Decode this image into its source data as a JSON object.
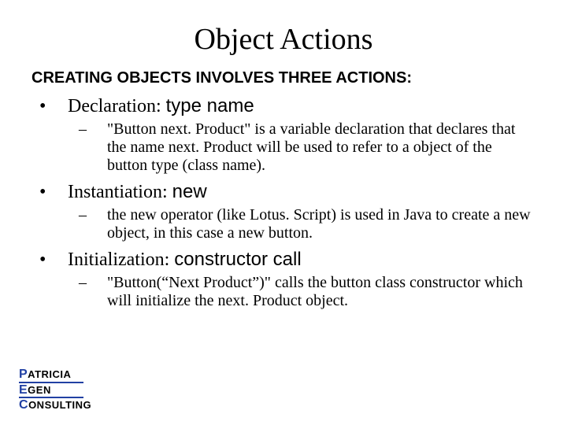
{
  "title": "Object Actions",
  "subtitle": "CREATING OBJECTS INVOLVES THREE ACTIONS:",
  "bullets": [
    {
      "label": "Declaration:",
      "code": "type name",
      "sub": "\"Button next. Product\" is a variable declaration that declares that the name next. Product will be used to refer to a object of the button type (class name)."
    },
    {
      "label": "Instantiation:",
      "code": "new",
      "sub": "the new operator (like Lotus. Script) is used in Java to create a new object, in this case a new button."
    },
    {
      "label": "Initialization:",
      "code": "constructor call",
      "sub": "\"Button(“Next Product”)\" calls the button class constructor which will initialize the next. Product object."
    }
  ],
  "logo": {
    "l1_cap": "P",
    "l1_rest": "ATRICIA",
    "l2_cap": "E",
    "l2_rest": "GEN",
    "l3_cap": "C",
    "l3_rest": "ONSULTING"
  }
}
